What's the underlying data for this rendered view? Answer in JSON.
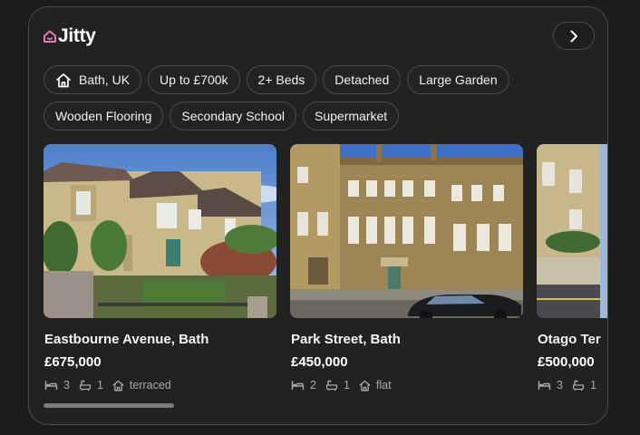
{
  "brand": {
    "name": "Jitty",
    "accent": "#e07ab8"
  },
  "filters": [
    {
      "label": "Bath, UK",
      "icon": "home-icon"
    },
    {
      "label": "Up to £700k"
    },
    {
      "label": "2+ Beds"
    },
    {
      "label": "Detached"
    },
    {
      "label": "Large Garden"
    },
    {
      "label": "Wooden Flooring"
    },
    {
      "label": "Secondary School"
    },
    {
      "label": "Supermarket"
    }
  ],
  "listings": [
    {
      "title": "Eastbourne Avenue, Bath",
      "price": "£675,000",
      "beds": "3",
      "baths": "1",
      "type": "terraced"
    },
    {
      "title": "Park Street, Bath",
      "price": "£450,000",
      "beds": "2",
      "baths": "1",
      "type": "flat"
    },
    {
      "title": "Otago Ter",
      "price": "£500,000",
      "beds": "3",
      "baths": "1",
      "type": ""
    }
  ],
  "icons": {
    "next": "chevron-right-icon",
    "bed": "bed-icon",
    "bath": "bath-icon",
    "type": "house-icon"
  }
}
